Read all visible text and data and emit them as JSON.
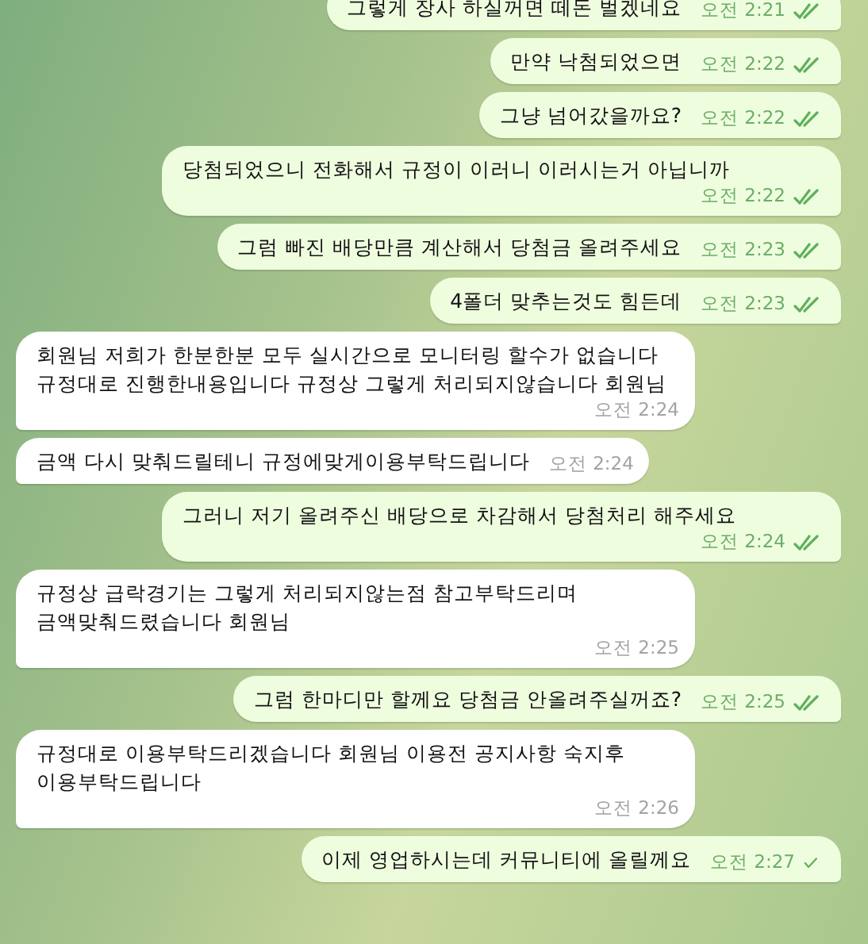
{
  "messages": [
    {
      "kind": "outgoing",
      "lines": [
        "그렇게 장사 하실꺼면 떼돈 벌겠네요"
      ],
      "time": "오전 2:21",
      "read": true
    },
    {
      "kind": "outgoing",
      "lines": [
        "만약 낙첨되었으면"
      ],
      "time": "오전 2:22",
      "read": true
    },
    {
      "kind": "outgoing",
      "lines": [
        "그냥 넘어갔을까요?"
      ],
      "time": "오전 2:22",
      "read": true
    },
    {
      "kind": "outgoing",
      "lines": [
        "당첨되었으니 전화해서 규정이 이러니 이러시는거 아닙니까"
      ],
      "time": "오전 2:22",
      "read": true
    },
    {
      "kind": "outgoing",
      "lines": [
        "그럼 빠진 배당만큼 계산해서 당첨금 올려주세요"
      ],
      "time": "오전 2:23",
      "read": true
    },
    {
      "kind": "outgoing",
      "lines": [
        "4폴더 맞추는것도 힘든데"
      ],
      "time": "오전 2:23",
      "read": true
    },
    {
      "kind": "incoming",
      "lines": [
        "회원님 저희가 한분한분 모두 실시간으로 모니터링 할수가 없습니다",
        "규정대로 진행한내용입니다 규정상 그렇게 처리되지않습니다 회원님"
      ],
      "time": "오전 2:24"
    },
    {
      "kind": "incoming",
      "lines": [
        "금액 다시 맞춰드릴테니 규정에맞게이용부탁드립니다"
      ],
      "time": "오전 2:24"
    },
    {
      "kind": "outgoing",
      "lines": [
        "그러니 저기 올려주신 배당으로 차감해서 당첨처리 해주세요"
      ],
      "time": "오전 2:24",
      "read": true
    },
    {
      "kind": "incoming",
      "lines": [
        "규정상 급락경기는 그렇게 처리되지않는점 참고부탁드리며",
        "금액맞춰드렸습니다 회원님"
      ],
      "time": "오전 2:25"
    },
    {
      "kind": "outgoing",
      "lines": [
        "그럼 한마디만 할께요 당첨금 안올려주실꺼죠?"
      ],
      "time": "오전 2:25",
      "read": true
    },
    {
      "kind": "incoming",
      "lines": [
        "규정대로 이용부탁드리겠습니다 회원님 이용전 공지사항 숙지후",
        "이용부탁드립니다"
      ],
      "time": "오전 2:26"
    },
    {
      "kind": "outgoing",
      "lines": [
        "이제 영업하시는데 커뮤니티에 올릴께요"
      ],
      "time": "오전 2:27",
      "read": false
    }
  ]
}
